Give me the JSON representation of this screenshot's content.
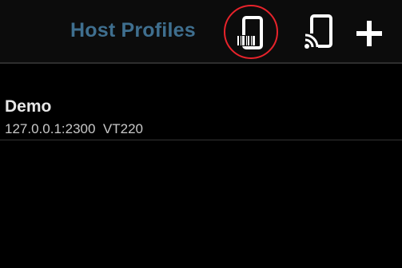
{
  "header": {
    "title": "Host Profiles",
    "actions": [
      {
        "name": "scan-barcode-action",
        "icon": "phone-barcode-icon",
        "highlighted": true
      },
      {
        "name": "cast-action",
        "icon": "cast-icon"
      },
      {
        "name": "add-action",
        "icon": "plus-icon"
      }
    ]
  },
  "profiles": [
    {
      "name": "Demo",
      "address": "127.0.0.1:2300",
      "terminal": "VT220",
      "detail": "127.0.0.1:2300  VT220"
    }
  ],
  "colors": {
    "title": "#3f6f8f",
    "highlight": "#e8232b",
    "icon": "#ffffff",
    "background": "#000000"
  }
}
